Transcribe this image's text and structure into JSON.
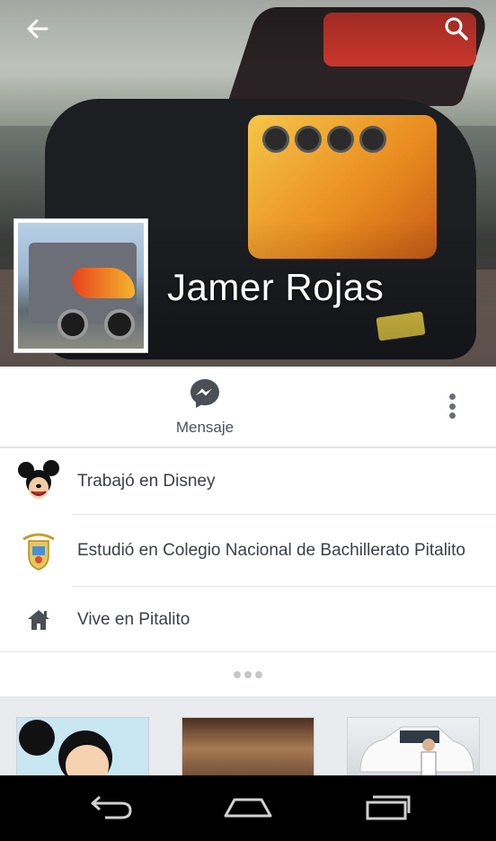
{
  "profile": {
    "name": "Jamer Rojas"
  },
  "header": {
    "back_icon": "arrow-left-icon",
    "search_icon": "search-icon"
  },
  "actions": {
    "message_label": "Mensaje",
    "message_icon": "messenger-icon",
    "more_icon": "more-vertical-icon",
    "accent_color": "#4b4f56"
  },
  "info": {
    "items": [
      {
        "icon": "mickey-icon",
        "text": "Trabajó en Disney"
      },
      {
        "icon": "school-crest-icon",
        "text": "Estudió en Colegio Nacional de Bachillerato Pitalito"
      },
      {
        "icon": "home-icon",
        "text": "Vive en Pitalito"
      }
    ],
    "see_more_icon": "ellipsis-icon"
  },
  "photos": {
    "items": [
      {
        "label": "mickey-photo"
      },
      {
        "label": "car-photo"
      },
      {
        "label": "white-car-photo"
      }
    ]
  },
  "navbar": {
    "items": [
      "back-nav-icon",
      "home-nav-icon",
      "recent-apps-icon"
    ]
  }
}
